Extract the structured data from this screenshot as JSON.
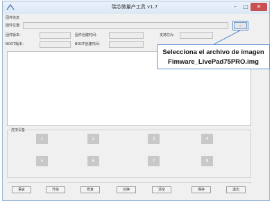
{
  "window": {
    "title": "瑞芯微量产工具 v1.7",
    "minimize": "–",
    "maximize": "□",
    "close": "✕"
  },
  "firmware_info": {
    "group_title": "固件信息",
    "location_label": "固件位置:",
    "version_label": "固件版本:",
    "create_time_label": "固件创建时间:",
    "chip_label": "支持芯片:",
    "boot_version_label": "BOOT版本:",
    "boot_create_time_label": "BOOT创建时间:",
    "browse_label": "..."
  },
  "callout": {
    "line1": "Selecciona el archivo de imagen",
    "line2": "Fimware_LivePad75PRO.img"
  },
  "devices": {
    "group_title": "连接设备",
    "slots": [
      "1",
      "2",
      "3",
      "4",
      "5",
      "6",
      "7",
      "8"
    ]
  },
  "buttons": {
    "language": "语言",
    "upgrade": "升级",
    "repair": "修复",
    "switch": "切换",
    "clear": "清空",
    "save": "保存",
    "exit": "退出"
  }
}
